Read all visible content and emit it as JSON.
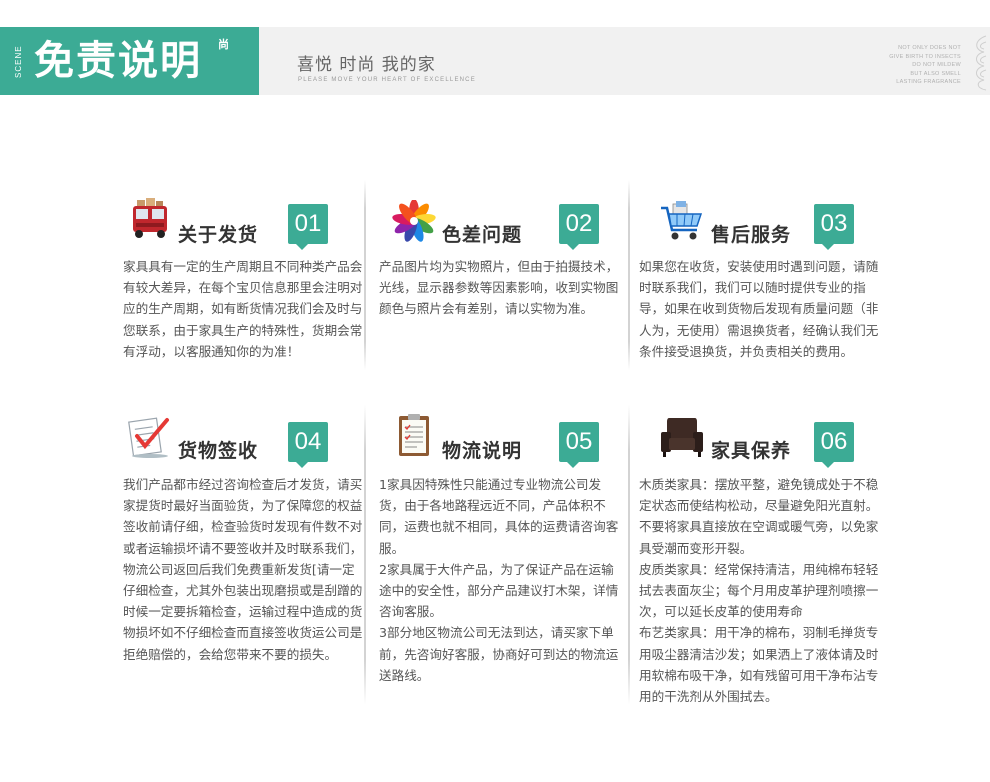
{
  "header": {
    "scene_label": "SCENE",
    "title": "免责说明",
    "title_badge": "尚",
    "subtitle": "喜悦  时尚  我的家",
    "subtitle_en": "PLEASE MOVE YOUR HEART OF EXCELLENCE",
    "en_lines": [
      "NOT ONLY DOES NOT",
      "GIVE BIRTH TO INSECTS",
      "DO NOT MILDEW",
      "BUT ALSO SMELL",
      "LASTING FRAGRANCE"
    ]
  },
  "colors": {
    "accent": "#3cab95",
    "band": "#f1f1f1",
    "text": "#555555",
    "heading": "#333333"
  },
  "cards": [
    {
      "icon": "delivery-truck-icon",
      "title": "关于发货",
      "number": "01",
      "paragraphs": [
        "家具具有一定的生产周期且不同种类产品会有较大差异，在每个宝贝信息那里会注明对应的生产周期，如有断货情况我们会及时与您联系，由于家具生产的特殊性，货期会常有浮动，以客服通知你的为准！"
      ]
    },
    {
      "icon": "color-palette-icon",
      "title": "色差问题",
      "number": "02",
      "paragraphs": [
        "产品图片均为实物照片，但由于拍摄技术，光线，显示器参数等因素影响，收到实物图颜色与照片会有差别，请以实物为准。"
      ]
    },
    {
      "icon": "shopping-cart-icon",
      "title": "售后服务",
      "number": "03",
      "paragraphs": [
        "如果您在收货，安装使用时遇到问题，请随时联系我们，我们可以随时提供专业的指导，如果在收到货物后发现有质量问题（非人为，无使用）需退换货者，经确认我们无条件接受退换货，并负责相关的费用。"
      ]
    },
    {
      "icon": "checklist-icon",
      "title": "货物签收",
      "number": "04",
      "paragraphs": [
        "我们产品都市经过咨询检查后才发货，请买家提货时最好当面验货，为了保障您的权益签收前请仔细，检查验货时发现有件数不对或者运输损坏请不要签收并及时联系我们，物流公司返回后我们免费重新发货[请一定仔细检查，尤其外包装出现磨损或是刮蹭的时候一定要拆箱检查，运输过程中造成的货物损坏如不仔细检查而直接签收货运公司是拒绝赔偿的，会给您带来不要的损失。"
      ]
    },
    {
      "icon": "clipboard-icon",
      "title": "物流说明",
      "number": "05",
      "paragraphs": [
        "1家具因特殊性只能通过专业物流公司发货，由于各地路程远近不同，产品体积不同，运费也就不相同，具体的运费请咨询客服。",
        "2家具属于大件产品，为了保证产品在运输途中的安全性，部分产品建议打木架，详情咨询客服。",
        "3部分地区物流公司无法到达，请买家下单前，先咨询好客服，协商好可到达的物流运送路线。"
      ]
    },
    {
      "icon": "armchair-icon",
      "title": "家具保养",
      "number": "06",
      "paragraphs": [
        "木质类家具：摆放平整，避免镜成处于不稳定状态而使结构松动，尽量避免阳光直射。不要将家具直接放在空调或暖气旁，以免家具受潮而变形开裂。",
        "皮质类家具：经常保持清洁，用纯棉布轻轻拭去表面灰尘；每个月用皮革护理剂喷擦一次，可以延长皮革的使用寿命",
        "布艺类家具：用干净的棉布，羽制毛掸货专用吸尘器清洁沙发；如果洒上了液体请及时用软棉布吸干净，如有残留可用干净布沾专用的干洗剂从外围拭去。"
      ]
    }
  ]
}
